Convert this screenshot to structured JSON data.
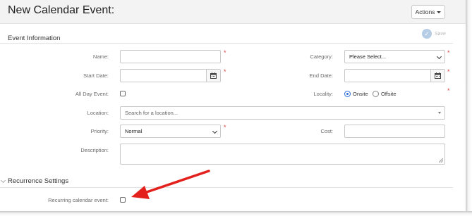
{
  "header": {
    "title": "New Calendar Event:",
    "actions_label": "Actions"
  },
  "toolbar": {
    "save_label": "Save"
  },
  "event_info": {
    "section_title": "Event Information",
    "name": {
      "label": "Name:",
      "value": ""
    },
    "category": {
      "label": "Category:",
      "selected": "Please Select..."
    },
    "start_date": {
      "label": "Start Date:",
      "value": ""
    },
    "end_date": {
      "label": "End Date:",
      "value": ""
    },
    "all_day": {
      "label": "All Day Event:",
      "checked": false
    },
    "locality": {
      "label": "Locality:",
      "options": [
        "Onsite",
        "Offsite"
      ],
      "selected": "Onsite"
    },
    "location": {
      "label": "Location:",
      "placeholder": "Search for a location..."
    },
    "priority": {
      "label": "Priority:",
      "selected": "Normal"
    },
    "cost": {
      "label": "Cost:",
      "value": ""
    },
    "description": {
      "label": "Description:",
      "value": ""
    }
  },
  "recurrence": {
    "section_title": "Recurrence Settings",
    "recurring": {
      "label": "Recurring calendar event:",
      "checked": false
    }
  },
  "colors": {
    "required": "#d83a3a",
    "arrow": "#e3201b",
    "radio_accent": "#2a6fd6",
    "save_icon": "#b6cde6"
  },
  "icons": [
    "caret-down-icon",
    "check-circle-icon",
    "calendar-icon",
    "chevron-down-icon",
    "red-arrow-icon"
  ]
}
